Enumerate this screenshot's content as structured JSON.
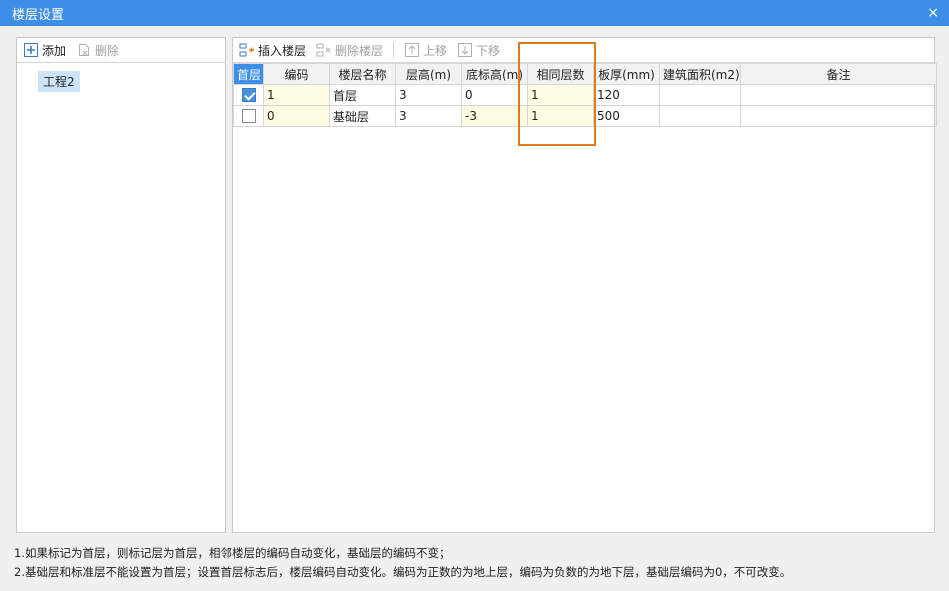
{
  "window": {
    "title": "楼层设置",
    "close_glyph": "×"
  },
  "left_toolbar": {
    "add_label": "添加",
    "delete_label": "删除"
  },
  "tree": {
    "root": "工程2"
  },
  "right_toolbar": {
    "insert_label": "插入楼层",
    "delete_label": "删除楼层",
    "up_label": "上移",
    "down_label": "下移"
  },
  "table": {
    "headers": [
      "首层",
      "编码",
      "楼层名称",
      "层高(m)",
      "底标高(m)",
      "相同层数",
      "板厚(mm)",
      "建筑面积(m2)",
      "备注"
    ],
    "rows": [
      {
        "first_floor": true,
        "code": "1",
        "name": "首层",
        "height": "3",
        "bottom_elev": "0",
        "same_count": "1",
        "slab": "120",
        "area": "",
        "note": ""
      },
      {
        "first_floor": false,
        "code": "0",
        "name": "基础层",
        "height": "3",
        "bottom_elev": "-3",
        "same_count": "1",
        "slab": "500",
        "area": "",
        "note": ""
      }
    ]
  },
  "notes": [
    "1.如果标记为首层，则标记层为首层，相邻楼层的编码自动变化，基础层的编码不变；",
    "2.基础层和标准层不能设置为首层；设置首层标志后，楼层编码自动变化。编码为正数的为地上层，编码为负数的为地下层，基础层编码为0，不可改变。"
  ],
  "colors": {
    "title_bar": "#3d8ee6",
    "highlight": "#e07b1a",
    "editable_cell": "#fffde3"
  }
}
